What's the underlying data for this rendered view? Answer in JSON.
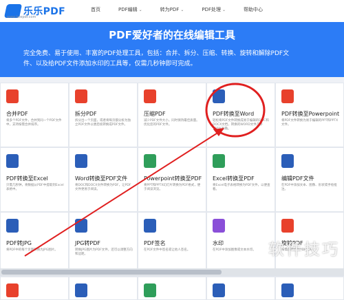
{
  "logo": {
    "name": "乐乐PDF",
    "sub": "www.lelepdf.com"
  },
  "nav": [
    {
      "label": "首页",
      "caret": false
    },
    {
      "label": "PDF编辑",
      "caret": true
    },
    {
      "label": "转为PDF",
      "caret": true
    },
    {
      "label": "PDF处理",
      "caret": true
    },
    {
      "label": "帮助中心",
      "caret": false
    }
  ],
  "hero": {
    "title": "PDF爱好者的在线编辑工具",
    "line1": "完全免费、易于使用、丰富的PDF处理工具，包括：合并、拆分、压缩、转换、旋转和解除PDF文",
    "line2": "件、以及给PDF文件添加水印的工具等，仅需几秒钟即可完成。"
  },
  "tools": [
    {
      "title": "合并PDF",
      "desc": "将多个PDF文件，合并到同一个PDF文件中，支持按需合并排序。",
      "color": "#e8412c"
    },
    {
      "title": "拆分PDF",
      "desc": "拆分出一个页面，或者将每页都分拆为独立PDF文件以便后续转换成PDF文件。",
      "color": "#e8412c"
    },
    {
      "title": "压缩PDF",
      "desc": "减少PDF文件大小，同时保持最佳质量。优化您的PDF文件。",
      "color": "#e8412c"
    },
    {
      "title": "PDF转换至Word",
      "desc": "轻松将PDF文件转换成易于编辑的DOC和DOCX文档，转换的WORD文件几乎100%准确。",
      "color": "#2b5eb8"
    },
    {
      "title": "PDF转换至Powerpoint",
      "desc": "将PDF文件转换为易于编辑的PPT和PPTX文件。",
      "color": "#e8412c"
    },
    {
      "title": "PDF转换至Excel",
      "desc": "只需几秒钟，将数据从PDF中提取到Excel表格中。",
      "color": "#2b5eb8"
    },
    {
      "title": "Word转换至PDF文件",
      "desc": "将DOC和DOCX文件转换为PDF，让PDF文件更易于阅读。",
      "color": "#2b5eb8"
    },
    {
      "title": "Powerpoint转换至PDF",
      "desc": "将PPT和PPTX幻灯片转换为PDF格式，便于阅读浏览。",
      "color": "#2f9e5a"
    },
    {
      "title": "Excel转换至PDF",
      "desc": "将Excel电子表格转换为PDF文件，以便查看。",
      "color": "#2f9e5a"
    },
    {
      "title": "编辑PDF文件",
      "desc": "在PDF中添加文本、图像、形状或手绘批注。",
      "color": "#2b5eb8"
    },
    {
      "title": "PDF转JPG",
      "desc": "将PDF中的每个页面转换为JPG图片。",
      "color": "#2b5eb8"
    },
    {
      "title": "JPG转PDF",
      "desc": "转换JPG图片为PDF文件，还可以调整方向和边距。",
      "color": "#2b5eb8"
    },
    {
      "title": "PDF签名",
      "desc": "在PDF文件中签名或让他人签名。",
      "color": "#2b5eb8"
    },
    {
      "title": "水印",
      "desc": "在PDF中添加图像或文本水印。",
      "color": "#8a4fd8"
    },
    {
      "title": "旋转PDF",
      "desc": "按需旋转您的PDF文件。",
      "color": "#e8412c"
    }
  ],
  "watermark": "软件技巧"
}
